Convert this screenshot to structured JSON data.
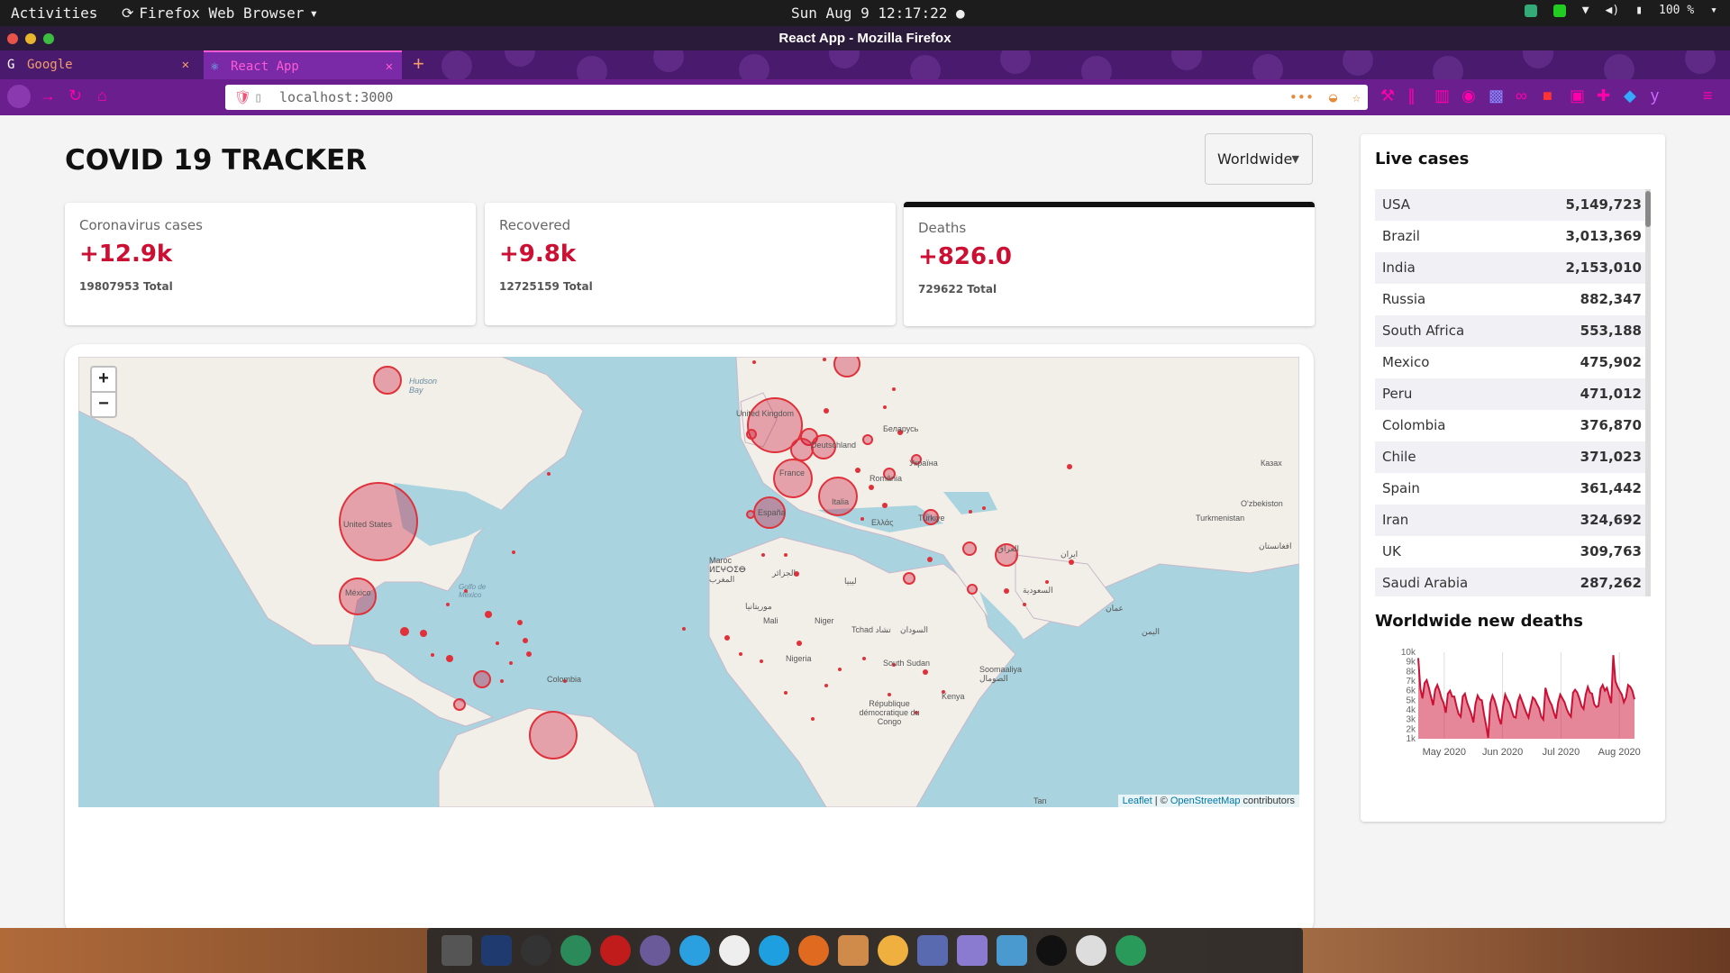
{
  "system_bar": {
    "activities": "Activities",
    "app_menu": "Firefox Web Browser",
    "clock": "Sun Aug 9 12:17:22",
    "battery": "100 %"
  },
  "window": {
    "title": "React App - Mozilla Firefox"
  },
  "tabs": [
    {
      "label": "Google"
    },
    {
      "label": "React App"
    }
  ],
  "address_bar": {
    "url": "localhost:3000"
  },
  "app": {
    "title": "COVID 19 TRACKER",
    "country_select": "Worldwide"
  },
  "info_boxes": [
    {
      "title": "Coronavirus cases",
      "value": "+12.9k",
      "total": "19807953 Total"
    },
    {
      "title": "Recovered",
      "value": "+9.8k",
      "total": "12725159 Total"
    },
    {
      "title": "Deaths",
      "value": "+826.0",
      "total": "729622 Total"
    }
  ],
  "map": {
    "zoom_in": "+",
    "zoom_out": "−",
    "labels": [
      "Hudson Bay",
      "United Kingdom",
      "Deutschland",
      "Беларусь",
      "Україна",
      "France",
      "România",
      "Italia",
      "España",
      "Ελλάς",
      "Türkiye",
      "Казах",
      "O'zbekiston",
      "Turkmenistan",
      "United States",
      "México",
      "Golfo de México",
      "Maroc ⵍⵎⵖⵔⵉⴱ المغرب",
      "الجزائر",
      "ليبيا",
      "Mali",
      "Niger",
      "Tchad تشاد",
      "السودان",
      "Nigeria",
      "South Sudan",
      "Soomaaliya الصومال",
      "Kenya",
      "République démocratique du Congo",
      "Colombia",
      "العراق",
      "ایران",
      "السعودية",
      "عمان",
      "اليمن",
      "Tan",
      "موريتانيا",
      "افغانستان"
    ],
    "attribution_leaflet": "Leaflet",
    "attribution_sep": " | © ",
    "attribution_osm": "OpenStreetMap",
    "attribution_tail": " contributors"
  },
  "live_cases": {
    "title": "Live cases",
    "rows": [
      {
        "country": "USA",
        "cases": "5,149,723"
      },
      {
        "country": "Brazil",
        "cases": "3,013,369"
      },
      {
        "country": "India",
        "cases": "2,153,010"
      },
      {
        "country": "Russia",
        "cases": "882,347"
      },
      {
        "country": "South Africa",
        "cases": "553,188"
      },
      {
        "country": "Mexico",
        "cases": "475,902"
      },
      {
        "country": "Peru",
        "cases": "471,012"
      },
      {
        "country": "Colombia",
        "cases": "376,870"
      },
      {
        "country": "Chile",
        "cases": "371,023"
      },
      {
        "country": "Spain",
        "cases": "361,442"
      },
      {
        "country": "Iran",
        "cases": "324,692"
      },
      {
        "country": "UK",
        "cases": "309,763"
      },
      {
        "country": "Saudi Arabia",
        "cases": "287,262"
      }
    ]
  },
  "chart_data": {
    "type": "area",
    "title": "Worldwide new deaths",
    "xlabel": "",
    "ylabel": "",
    "ylim": [
      1000,
      10000
    ],
    "y_ticks": [
      "10k",
      "9k",
      "8k",
      "7k",
      "6k",
      "5k",
      "4k",
      "3k",
      "2k",
      "1k"
    ],
    "x_ticks": [
      "May 2020",
      "Jun 2020",
      "Jul 2020",
      "Aug 2020"
    ],
    "series": [
      {
        "values": [
          9400,
          6200,
          5200,
          6800,
          7100,
          6300,
          5400,
          4500,
          6100,
          6600,
          6000,
          5200,
          4700,
          3700,
          5700,
          6000,
          5400,
          5400,
          4400,
          3600,
          3300,
          5400,
          5700,
          4800,
          4200,
          3600,
          2700,
          4600,
          5500,
          5100,
          5000,
          3600,
          2400,
          1100,
          4700,
          5500,
          5000,
          4200,
          3200,
          2500,
          4300,
          5600,
          5100,
          4700,
          4000,
          3300,
          3200,
          4900,
          5500,
          4900,
          4300,
          3700,
          3200,
          4300,
          5300,
          5100,
          4600,
          4200,
          3300,
          3000,
          6300,
          5500,
          4900,
          4500,
          3700,
          3100,
          4800,
          5600,
          5200,
          4800,
          4100,
          3600,
          3300,
          5800,
          6100,
          5800,
          5200,
          4400,
          4100,
          5600,
          6400,
          5800,
          5700,
          4600,
          4300,
          4400,
          6200,
          6600,
          6000,
          6300,
          5500,
          4700,
          9700,
          7000,
          6400,
          6000,
          5600,
          4800,
          5300,
          6600,
          6400,
          6000,
          5100
        ]
      }
    ],
    "colors": {
      "line": "#cc1034",
      "fill": "rgba(204,16,52,0.5)"
    }
  }
}
